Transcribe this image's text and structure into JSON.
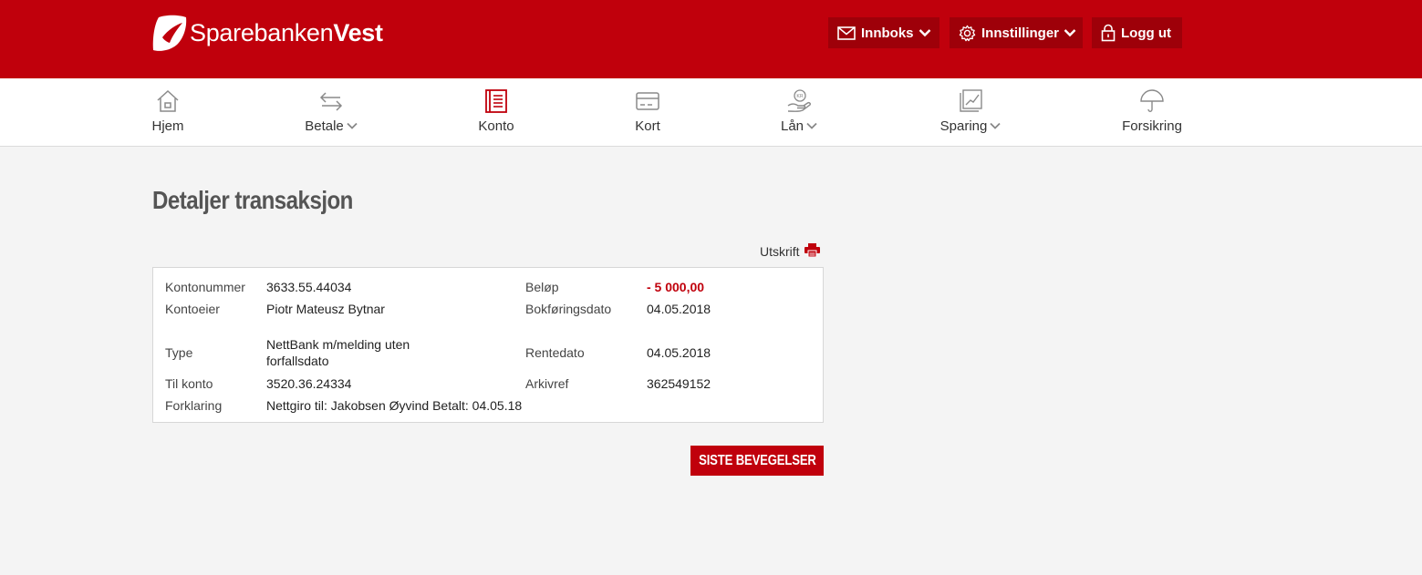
{
  "header": {
    "logo": {
      "text_light": "Sparebanken",
      "text_bold": "Vest"
    },
    "buttons": {
      "innboks": "Innboks",
      "innstillinger": "Innstillinger",
      "logg_ut": "Logg ut"
    }
  },
  "nav": {
    "items": [
      {
        "label": "Hjem",
        "icon": "home-icon"
      },
      {
        "label": "Betale",
        "icon": "transfer-arrows-icon"
      },
      {
        "label": "Konto",
        "icon": "account-book-icon"
      },
      {
        "label": "Kort",
        "icon": "card-icon"
      },
      {
        "label": "Lån",
        "icon": "loan-hand-icon"
      },
      {
        "label": "Sparing",
        "icon": "savings-chart-icon"
      },
      {
        "label": "Forsikring",
        "icon": "umbrella-icon"
      }
    ]
  },
  "main": {
    "title": "Detaljer transaksjon",
    "print_label": "Utskrift",
    "details": {
      "kontonummer": {
        "label": "Kontonummer",
        "value": "3633.55.44034"
      },
      "kontoeier": {
        "label": "Kontoeier",
        "value": "Piotr Mateusz Bytnar"
      },
      "type": {
        "label": "Type",
        "value": "NettBank m/melding uten forfallsdato"
      },
      "til_konto": {
        "label": "Til konto",
        "value": "3520.36.24334"
      },
      "forklaring": {
        "label": "Forklaring",
        "value": "Nettgiro til: Jakobsen Øyvind Betalt: 04.05.18"
      },
      "belop": {
        "label": "Beløp",
        "value": "- 5 000,00"
      },
      "bokforingsdato": {
        "label": "Bokføringsdato",
        "value": "04.05.2018"
      },
      "rentedato": {
        "label": "Rentedato",
        "value": "04.05.2018"
      },
      "arkivref": {
        "label": "Arkivref",
        "value": "362549152"
      }
    },
    "button_label": "SISTE BEVEGELSER"
  },
  "colors": {
    "brand_red": "#c0000c",
    "header_button_bg": "#9e0009",
    "page_bg": "#f4f4f4"
  }
}
